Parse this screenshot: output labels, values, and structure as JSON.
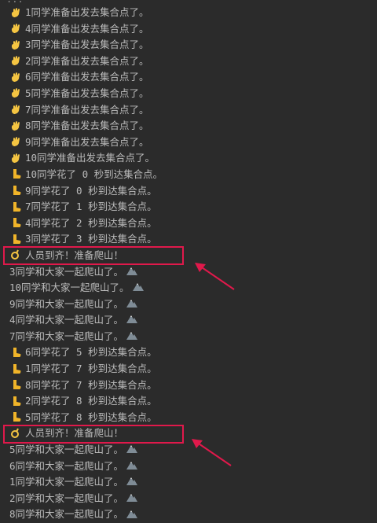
{
  "console": {
    "top_partial": "...",
    "lines": [
      {
        "icon": "wave",
        "text": "1同学准备出发去集合点了。"
      },
      {
        "icon": "wave",
        "text": "4同学准备出发去集合点了。"
      },
      {
        "icon": "wave",
        "text": "3同学准备出发去集合点了。"
      },
      {
        "icon": "wave",
        "text": "2同学准备出发去集合点了。"
      },
      {
        "icon": "wave",
        "text": "6同学准备出发去集合点了。"
      },
      {
        "icon": "wave",
        "text": "5同学准备出发去集合点了。"
      },
      {
        "icon": "wave",
        "text": "7同学准备出发去集合点了。"
      },
      {
        "icon": "wave",
        "text": "8同学准备出发去集合点了。"
      },
      {
        "icon": "wave",
        "text": "9同学准备出发去集合点了。"
      },
      {
        "icon": "wave",
        "text": "10同学准备出发去集合点了。"
      },
      {
        "icon": "foot",
        "text": "10同学花了 0 秒到达集合点。"
      },
      {
        "icon": "foot",
        "text": "9同学花了 0 秒到达集合点。"
      },
      {
        "icon": "foot",
        "text": "7同学花了 1 秒到达集合点。"
      },
      {
        "icon": "foot",
        "text": "4同学花了 2 秒到达集合点。"
      },
      {
        "icon": "foot",
        "text": "3同学花了 3 秒到达集合点。"
      },
      {
        "icon": "ok",
        "text": "人员到齐！准备爬山！"
      },
      {
        "icon": "none",
        "text": "3同学和大家一起爬山了。",
        "mountain": true
      },
      {
        "icon": "none",
        "text": "10同学和大家一起爬山了。",
        "mountain": true
      },
      {
        "icon": "none",
        "text": "9同学和大家一起爬山了。",
        "mountain": true
      },
      {
        "icon": "none",
        "text": "4同学和大家一起爬山了。",
        "mountain": true
      },
      {
        "icon": "none",
        "text": "7同学和大家一起爬山了。",
        "mountain": true
      },
      {
        "icon": "foot",
        "text": "6同学花了 5 秒到达集合点。"
      },
      {
        "icon": "foot",
        "text": "1同学花了 7 秒到达集合点。"
      },
      {
        "icon": "foot",
        "text": "8同学花了 7 秒到达集合点。"
      },
      {
        "icon": "foot",
        "text": "2同学花了 8 秒到达集合点。"
      },
      {
        "icon": "foot",
        "text": "5同学花了 8 秒到达集合点。"
      },
      {
        "icon": "ok",
        "text": "人员到齐！准备爬山！"
      },
      {
        "icon": "none",
        "text": "5同学和大家一起爬山了。",
        "mountain": true
      },
      {
        "icon": "none",
        "text": "6同学和大家一起爬山了。",
        "mountain": true
      },
      {
        "icon": "none",
        "text": "1同学和大家一起爬山了。",
        "mountain": true
      },
      {
        "icon": "none",
        "text": "2同学和大家一起爬山了。",
        "mountain": true
      },
      {
        "icon": "none",
        "text": "8同学和大家一起爬山了。",
        "mountain": true
      }
    ]
  },
  "colors": {
    "background": "#2b2b2b",
    "text": "#bbbbbb",
    "highlight": "#e0194b",
    "wave": "#f5c542",
    "foot": "#f0b429",
    "mountain": "#7f8c96"
  }
}
